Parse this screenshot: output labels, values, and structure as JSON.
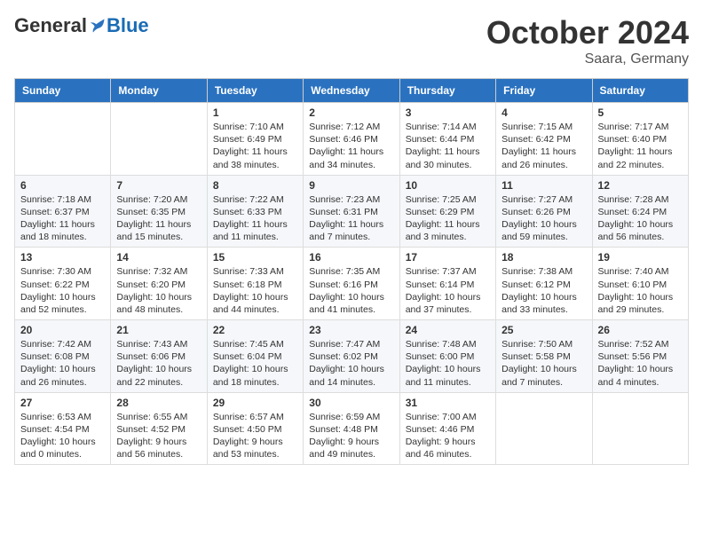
{
  "logo": {
    "general": "General",
    "blue": "Blue"
  },
  "title": "October 2024",
  "location": "Saara, Germany",
  "days_of_week": [
    "Sunday",
    "Monday",
    "Tuesday",
    "Wednesday",
    "Thursday",
    "Friday",
    "Saturday"
  ],
  "weeks": [
    [
      {
        "day": "",
        "content": ""
      },
      {
        "day": "",
        "content": ""
      },
      {
        "day": "1",
        "content": "Sunrise: 7:10 AM\nSunset: 6:49 PM\nDaylight: 11 hours and 38 minutes."
      },
      {
        "day": "2",
        "content": "Sunrise: 7:12 AM\nSunset: 6:46 PM\nDaylight: 11 hours and 34 minutes."
      },
      {
        "day": "3",
        "content": "Sunrise: 7:14 AM\nSunset: 6:44 PM\nDaylight: 11 hours and 30 minutes."
      },
      {
        "day": "4",
        "content": "Sunrise: 7:15 AM\nSunset: 6:42 PM\nDaylight: 11 hours and 26 minutes."
      },
      {
        "day": "5",
        "content": "Sunrise: 7:17 AM\nSunset: 6:40 PM\nDaylight: 11 hours and 22 minutes."
      }
    ],
    [
      {
        "day": "6",
        "content": "Sunrise: 7:18 AM\nSunset: 6:37 PM\nDaylight: 11 hours and 18 minutes."
      },
      {
        "day": "7",
        "content": "Sunrise: 7:20 AM\nSunset: 6:35 PM\nDaylight: 11 hours and 15 minutes."
      },
      {
        "day": "8",
        "content": "Sunrise: 7:22 AM\nSunset: 6:33 PM\nDaylight: 11 hours and 11 minutes."
      },
      {
        "day": "9",
        "content": "Sunrise: 7:23 AM\nSunset: 6:31 PM\nDaylight: 11 hours and 7 minutes."
      },
      {
        "day": "10",
        "content": "Sunrise: 7:25 AM\nSunset: 6:29 PM\nDaylight: 11 hours and 3 minutes."
      },
      {
        "day": "11",
        "content": "Sunrise: 7:27 AM\nSunset: 6:26 PM\nDaylight: 10 hours and 59 minutes."
      },
      {
        "day": "12",
        "content": "Sunrise: 7:28 AM\nSunset: 6:24 PM\nDaylight: 10 hours and 56 minutes."
      }
    ],
    [
      {
        "day": "13",
        "content": "Sunrise: 7:30 AM\nSunset: 6:22 PM\nDaylight: 10 hours and 52 minutes."
      },
      {
        "day": "14",
        "content": "Sunrise: 7:32 AM\nSunset: 6:20 PM\nDaylight: 10 hours and 48 minutes."
      },
      {
        "day": "15",
        "content": "Sunrise: 7:33 AM\nSunset: 6:18 PM\nDaylight: 10 hours and 44 minutes."
      },
      {
        "day": "16",
        "content": "Sunrise: 7:35 AM\nSunset: 6:16 PM\nDaylight: 10 hours and 41 minutes."
      },
      {
        "day": "17",
        "content": "Sunrise: 7:37 AM\nSunset: 6:14 PM\nDaylight: 10 hours and 37 minutes."
      },
      {
        "day": "18",
        "content": "Sunrise: 7:38 AM\nSunset: 6:12 PM\nDaylight: 10 hours and 33 minutes."
      },
      {
        "day": "19",
        "content": "Sunrise: 7:40 AM\nSunset: 6:10 PM\nDaylight: 10 hours and 29 minutes."
      }
    ],
    [
      {
        "day": "20",
        "content": "Sunrise: 7:42 AM\nSunset: 6:08 PM\nDaylight: 10 hours and 26 minutes."
      },
      {
        "day": "21",
        "content": "Sunrise: 7:43 AM\nSunset: 6:06 PM\nDaylight: 10 hours and 22 minutes."
      },
      {
        "day": "22",
        "content": "Sunrise: 7:45 AM\nSunset: 6:04 PM\nDaylight: 10 hours and 18 minutes."
      },
      {
        "day": "23",
        "content": "Sunrise: 7:47 AM\nSunset: 6:02 PM\nDaylight: 10 hours and 14 minutes."
      },
      {
        "day": "24",
        "content": "Sunrise: 7:48 AM\nSunset: 6:00 PM\nDaylight: 10 hours and 11 minutes."
      },
      {
        "day": "25",
        "content": "Sunrise: 7:50 AM\nSunset: 5:58 PM\nDaylight: 10 hours and 7 minutes."
      },
      {
        "day": "26",
        "content": "Sunrise: 7:52 AM\nSunset: 5:56 PM\nDaylight: 10 hours and 4 minutes."
      }
    ],
    [
      {
        "day": "27",
        "content": "Sunrise: 6:53 AM\nSunset: 4:54 PM\nDaylight: 10 hours and 0 minutes."
      },
      {
        "day": "28",
        "content": "Sunrise: 6:55 AM\nSunset: 4:52 PM\nDaylight: 9 hours and 56 minutes."
      },
      {
        "day": "29",
        "content": "Sunrise: 6:57 AM\nSunset: 4:50 PM\nDaylight: 9 hours and 53 minutes."
      },
      {
        "day": "30",
        "content": "Sunrise: 6:59 AM\nSunset: 4:48 PM\nDaylight: 9 hours and 49 minutes."
      },
      {
        "day": "31",
        "content": "Sunrise: 7:00 AM\nSunset: 4:46 PM\nDaylight: 9 hours and 46 minutes."
      },
      {
        "day": "",
        "content": ""
      },
      {
        "day": "",
        "content": ""
      }
    ]
  ]
}
